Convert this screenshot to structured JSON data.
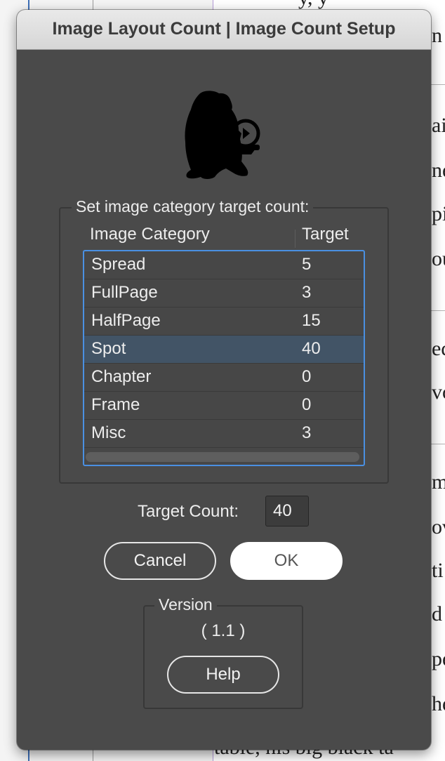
{
  "window": {
    "title": "Image Layout Count | Image Count Setup"
  },
  "category_group": {
    "legend": "Set image category target count:",
    "columns": [
      "Image Category",
      "Target"
    ],
    "rows": [
      {
        "category": "Spread",
        "target": "5"
      },
      {
        "category": "FullPage",
        "target": "3"
      },
      {
        "category": "HalfPage",
        "target": "15"
      },
      {
        "category": "Spot",
        "target": "40"
      },
      {
        "category": "Chapter",
        "target": "0"
      },
      {
        "category": "Frame",
        "target": "0"
      },
      {
        "category": "Misc",
        "target": "3"
      }
    ],
    "selected_category": "Spot"
  },
  "target_count": {
    "label": "Target Count:",
    "value": "40"
  },
  "buttons": {
    "cancel": "Cancel",
    "ok": "OK",
    "help": "Help"
  },
  "version": {
    "legend": "Version",
    "value": "( 1.1 )"
  },
  "background_document": {
    "fragments": [
      "n",
      "ai",
      "ne",
      "pi",
      "ou",
      "ed",
      "vo",
      "m",
      "ov",
      "ti",
      "d",
      "pe",
      "he"
    ],
    "top_fragment": "y, y",
    "bottom_fragment": "table, his big black ta"
  },
  "colors": {
    "dialog_bg": "#4a4a4a",
    "titlebar_bg": "#dedede",
    "selection": "#425466",
    "focus_ring": "#4a90e2",
    "text": "#ededed"
  },
  "icons": {
    "logo": "bear-with-lantern-icon"
  }
}
